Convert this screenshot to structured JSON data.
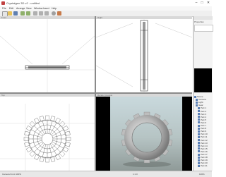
{
  "window": {
    "title": "Crystalgen 3D v2 - untitled",
    "minimize": "–",
    "maximize": "□",
    "close": "✕"
  },
  "menu": [
    "File",
    "Edit",
    "Arrange",
    "View",
    "Window",
    "Insert",
    "Help"
  ],
  "toolbar": {
    "icons": [
      "new-icon",
      "open-icon",
      "save-icon",
      "undo-icon",
      "redo-icon",
      "move-icon",
      "rotate-icon",
      "scale-icon",
      "gear-icon",
      "render-icon"
    ]
  },
  "viewports": {
    "top_left": {
      "label": "Front"
    },
    "top_right": {
      "label": "Right"
    },
    "bottom_left": {
      "label": "Top"
    },
    "bottom_right": {
      "label": "Render preview"
    }
  },
  "side_panel": {
    "title": "Properties",
    "tree": [
      "Scene",
      "Camera",
      "Light",
      "Gear",
      "Part 1",
      "Part 2",
      "Part 3",
      "Part 4",
      "Part 5",
      "Part 6",
      "Part 7",
      "Part 8",
      "Part 9",
      "Part 10",
      "Part 11",
      "Part 12",
      "Part 13",
      "Part 14",
      "Part 15",
      "Part 16",
      "Part 17",
      "Part 18",
      "Part 19",
      "Part 20",
      "Part 21"
    ]
  },
  "status": {
    "left": "Camera  Front  100%",
    "middle": "1:1 0",
    "right": "100%"
  },
  "colors": {
    "workspace_bg": "#8a8a8a",
    "viewport_bg": "#ffffff",
    "render_sky_top": "#c9d9dd",
    "render_sky_bottom": "#9fa9a9",
    "tree_icon": "#5a7fb5"
  }
}
